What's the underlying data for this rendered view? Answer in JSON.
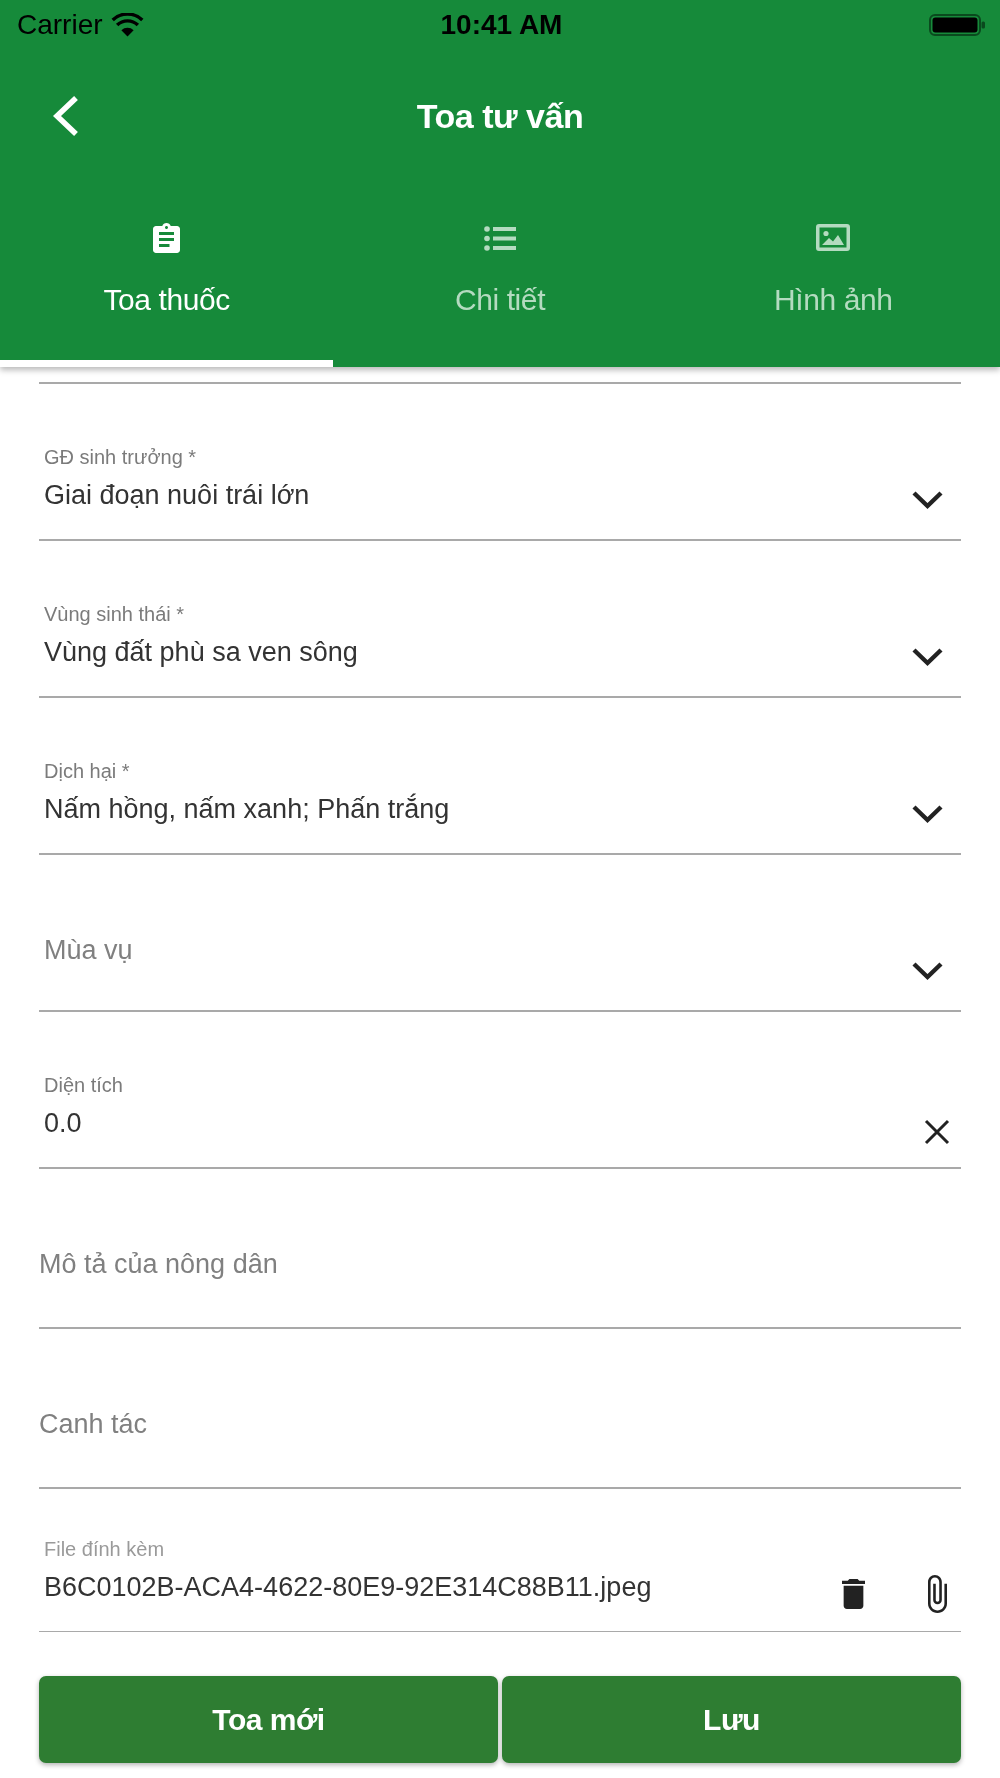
{
  "status_bar": {
    "carrier": "Carrier",
    "time": "10:41 AM"
  },
  "nav_bar": {
    "title": "Toa tư vấn"
  },
  "tabs": [
    {
      "label": "Toa thuốc",
      "selected": true
    },
    {
      "label": "Chi tiết",
      "selected": false
    },
    {
      "label": "Hình ảnh",
      "selected": false
    }
  ],
  "fields": [
    {
      "kind": "select",
      "label": "GĐ sinh trưởng *",
      "value": "Giai đoạn nuôi trái lớn"
    },
    {
      "kind": "select",
      "label": "Vùng sinh thái *",
      "value": "Vùng đất phù sa ven sông"
    },
    {
      "kind": "select",
      "label": "Dịch hại *",
      "value": "Nấm hồng, nấm xanh; Phấn trắng"
    },
    {
      "kind": "select",
      "placeholder": "Mùa vụ"
    },
    {
      "kind": "clearable",
      "label": "Diện tích",
      "value": "0.0"
    },
    {
      "kind": "text",
      "placeholder": "Mô tả của nông dân"
    },
    {
      "kind": "text",
      "placeholder": "Canh tác"
    },
    {
      "kind": "file",
      "label": "File đính kèm",
      "value": "B6C0102B-ACA4-4622-80E9-92E314C88B11.jpeg"
    }
  ],
  "buttons": [
    "Toa mới",
    "Lưu"
  ]
}
